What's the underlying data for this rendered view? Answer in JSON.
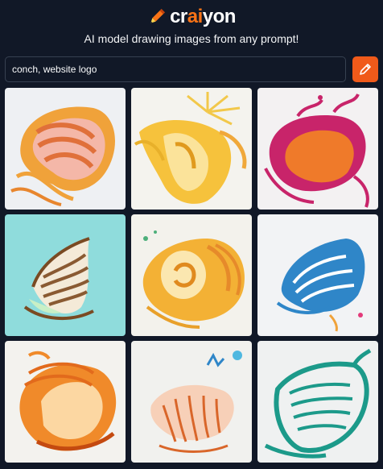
{
  "app": {
    "logo_prefix": "cr",
    "logo_accent": "ai",
    "logo_suffix": "yon",
    "tagline": "AI model drawing images from any prompt!",
    "accent_color": "#f97316"
  },
  "search": {
    "value": "conch, website logo",
    "button_icon": "pencil-icon"
  },
  "results": [
    {
      "subject": "orange-pink-spiral-conch"
    },
    {
      "subject": "yellow-sunburst-conch"
    },
    {
      "subject": "magenta-orange-conch"
    },
    {
      "subject": "striped-cone-shell-on-teal"
    },
    {
      "subject": "yellow-orange-swirl-shell"
    },
    {
      "subject": "blue-striped-conch"
    },
    {
      "subject": "orange-glossy-conch"
    },
    {
      "subject": "coral-reef-shell"
    },
    {
      "subject": "teal-line-art-shell"
    }
  ]
}
